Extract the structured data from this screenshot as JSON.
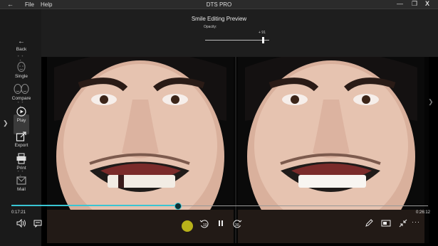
{
  "titlebar": {
    "back_glyph": "←",
    "menu": [
      "File",
      "Help"
    ],
    "title": "DTS PRO",
    "window_buttons": {
      "minimize": "—",
      "maximize": "❐",
      "close": "X"
    }
  },
  "header": {
    "preview_title": "Smile Editing Preview",
    "opacity_label": "Opacity:",
    "opacity_value": "+ 91",
    "opacity_level_percent": 91
  },
  "sidebar": {
    "back": "Back",
    "single": "Single",
    "compare": "Compare",
    "play": "Play",
    "export": "Export",
    "print": "Print",
    "mail": "Mail",
    "back_glyph": "←",
    "dots": "• • •"
  },
  "player": {
    "current_time": "0:17:21",
    "total_time": "0:26:12",
    "progress_percent": 40,
    "accent_color": "#39c5d3"
  },
  "controls": {
    "volume_icon": "volume-icon",
    "subtitles_icon": "subtitles-icon",
    "rewind_label": "10",
    "pause_icon": "pause-icon",
    "forward_label": "30",
    "edit_icon": "pencil-icon",
    "aspect_icon": "aspect-ratio-icon",
    "shrink_icon": "collapse-icon",
    "more_label": "···"
  }
}
